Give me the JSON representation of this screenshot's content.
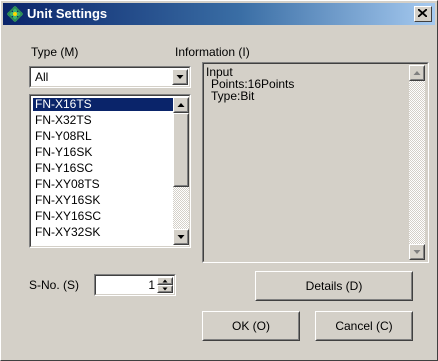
{
  "window": {
    "title": "Unit Settings"
  },
  "type": {
    "label": "Type (M)",
    "selected": "All"
  },
  "type_list": {
    "items": [
      "FN-X16TS",
      "FN-X32TS",
      "FN-Y08RL",
      "FN-Y16SK",
      "FN-Y16SC",
      "FN-XY08TS",
      "FN-XY16SK",
      "FN-XY16SC",
      "FN-XY32SK"
    ],
    "selected_index": 0
  },
  "information": {
    "label": "Information (I)",
    "lines": [
      "Input",
      " Points:16Points",
      " Type:Bit"
    ]
  },
  "sno": {
    "label": "S-No. (S)",
    "value": "1"
  },
  "buttons": {
    "details": "Details (D)",
    "ok": "OK (O)",
    "cancel": "Cancel (C)"
  },
  "colors": {
    "title_start": "#0a246a",
    "title_end": "#a6caf0",
    "face": "#d4d0c8",
    "selection": "#0a246a"
  }
}
